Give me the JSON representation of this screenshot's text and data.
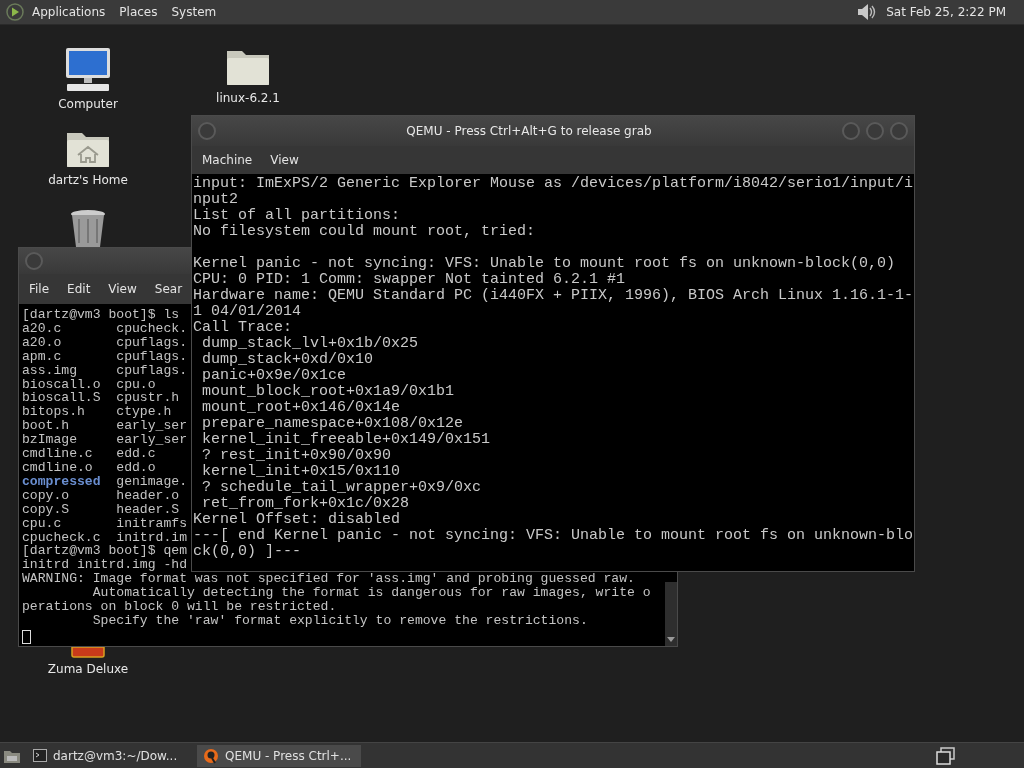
{
  "top_panel": {
    "menus": [
      "Applications",
      "Places",
      "System"
    ],
    "clock": "Sat Feb 25,  2:22 PM"
  },
  "desktop_icons": [
    {
      "kind": "computer",
      "label": "Computer"
    },
    {
      "kind": "folder",
      "label": "linux-6.2.1"
    },
    {
      "kind": "home",
      "label": "dartz's Home"
    },
    {
      "kind": "trash"
    },
    {
      "kind": "game",
      "label": "Zuma Deluxe"
    }
  ],
  "terminal": {
    "menus": [
      "File",
      "Edit",
      "View",
      "Sear"
    ],
    "lines_before": [
      "[dartz@vm3 boot]$ ls"
    ],
    "ls_rows": [
      {
        "name": "a20.c",
        "kind": "file",
        "next": "cpucheck."
      },
      {
        "name": "a20.o",
        "kind": "file",
        "next": "cpuflags."
      },
      {
        "name": "apm.c",
        "kind": "file",
        "next": "cpuflags."
      },
      {
        "name": "ass.img",
        "kind": "file",
        "next": "cpuflags."
      },
      {
        "name": "bioscall.o",
        "kind": "file",
        "next": "cpu.o"
      },
      {
        "name": "bioscall.S",
        "kind": "file",
        "next": "cpustr.h"
      },
      {
        "name": "bitops.h",
        "kind": "file",
        "next": "ctype.h"
      },
      {
        "name": "boot.h",
        "kind": "file",
        "next": "early_ser"
      },
      {
        "name": "bzImage",
        "kind": "file",
        "next": "early_ser"
      },
      {
        "name": "cmdline.c",
        "kind": "file",
        "next": "edd.c"
      },
      {
        "name": "cmdline.o",
        "kind": "file",
        "next": "edd.o"
      },
      {
        "name": "compressed",
        "kind": "dir",
        "next": "genimage."
      },
      {
        "name": "copy.o",
        "kind": "file",
        "next": "header.o"
      },
      {
        "name": "copy.S",
        "kind": "file",
        "next": "header.S"
      },
      {
        "name": "cpu.c",
        "kind": "file",
        "next": "initramfs"
      },
      {
        "name": "cpucheck.c",
        "kind": "file",
        "next": "initrd.im"
      }
    ],
    "lines_after": [
      "[dartz@vm3 boot]$ qem",
      "initrd initrd.img -hd",
      "WARNING: Image format was not specified for 'ass.img' and probing guessed raw.",
      "         Automatically detecting the format is dangerous for raw images, write o",
      "perations on block 0 will be restricted.",
      "         Specify the 'raw' format explicitly to remove the restrictions."
    ]
  },
  "qemu": {
    "title": "QEMU - Press Ctrl+Alt+G to release grab",
    "menus": [
      "Machine",
      "View"
    ],
    "console_blocks": [
      [
        "input: ImExPS/2 Generic Explorer Mouse as /devices/platform/i8042/serio1/input/i",
        "nput2",
        "List of all partitions:",
        "No filesystem could mount root, tried:"
      ],
      [
        "Kernel panic - not syncing: VFS: Unable to mount root fs on unknown-block(0,0)",
        "CPU: 0 PID: 1 Comm: swapper Not tainted 6.2.1 #1",
        "Hardware name: QEMU Standard PC (i440FX + PIIX, 1996), BIOS Arch Linux 1.16.1-1-",
        "1 04/01/2014",
        "Call Trace:",
        " dump_stack_lvl+0x1b/0x25",
        " dump_stack+0xd/0x10",
        " panic+0x9e/0x1ce",
        " mount_block_root+0x1a9/0x1b1",
        " mount_root+0x146/0x14e",
        " prepare_namespace+0x108/0x12e",
        " kernel_init_freeable+0x149/0x151",
        " ? rest_init+0x90/0x90",
        " kernel_init+0x15/0x110",
        " ? schedule_tail_wrapper+0x9/0xc",
        " ret_from_fork+0x1c/0x28",
        "Kernel Offset: disabled",
        "---[ end Kernel panic - not syncing: VFS: Unable to mount root fs on unknown-blo",
        "ck(0,0) ]---"
      ]
    ]
  },
  "taskbar": {
    "tasks": [
      {
        "kind": "terminal",
        "label": "dartz@vm3:~/Dow...",
        "selected": false
      },
      {
        "kind": "qemu",
        "label": "QEMU - Press Ctrl+...",
        "selected": true
      }
    ]
  }
}
